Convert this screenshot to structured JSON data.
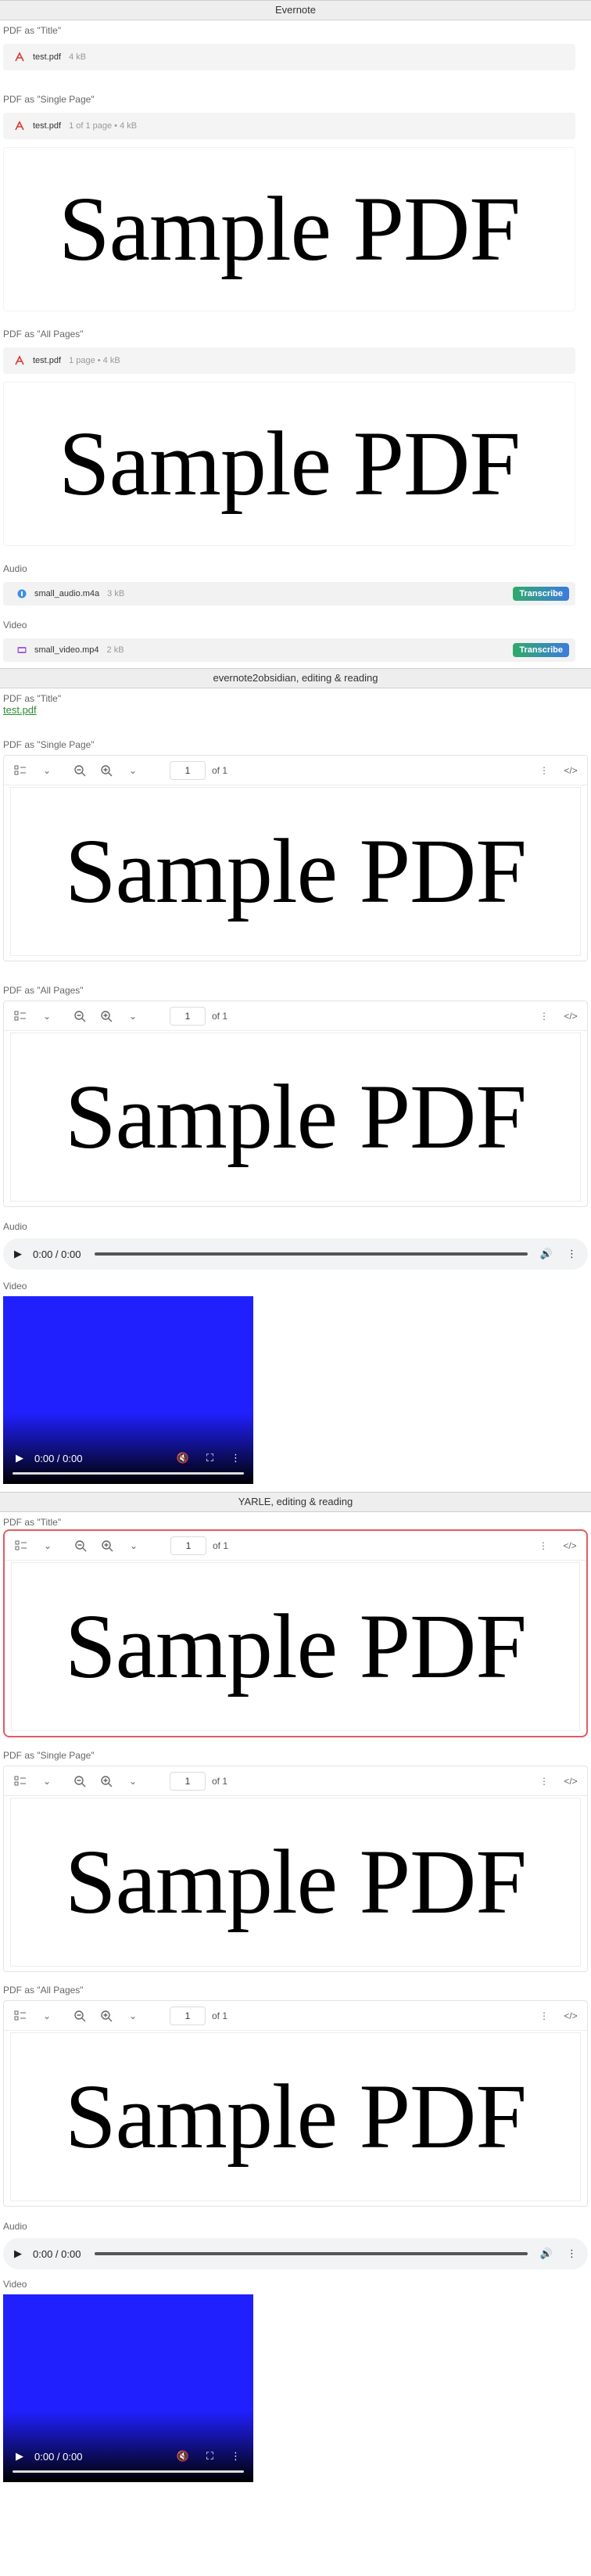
{
  "sections": {
    "evernote": {
      "header": "Evernote",
      "pdf_title": {
        "label": "PDF as \"Title\"",
        "filename": "test.pdf",
        "meta": "4 kB"
      },
      "pdf_single": {
        "label": "PDF as \"Single Page\"",
        "filename": "test.pdf",
        "meta": "1 of 1 page • 4 kB",
        "preview": "Sample PDF"
      },
      "pdf_all": {
        "label": "PDF as \"All Pages\"",
        "filename": "test.pdf",
        "meta": "1 page • 4 kB",
        "preview": "Sample PDF"
      },
      "audio": {
        "label": "Audio",
        "filename": "small_audio.m4a",
        "meta": "3 kB",
        "action": "Transcribe"
      },
      "video": {
        "label": "Video",
        "filename": "small_video.mp4",
        "meta": "2 kB",
        "action": "Transcribe"
      }
    },
    "e2o": {
      "header": "evernote2obsidian, editing & reading",
      "pdf_title": {
        "label": "PDF as \"Title\"",
        "link": "test.pdf"
      },
      "pdf_single": {
        "label": "PDF as \"Single Page\"",
        "page": "1",
        "of": "of 1",
        "preview": "Sample PDF"
      },
      "pdf_all": {
        "label": "PDF as \"All Pages\"",
        "page": "1",
        "of": "of 1",
        "preview": "Sample PDF"
      },
      "audio": {
        "label": "Audio",
        "time": "0:00 / 0:00"
      },
      "video": {
        "label": "Video",
        "time": "0:00 / 0:00"
      }
    },
    "yarle": {
      "header": "YARLE, editing & reading",
      "pdf_title": {
        "label": "PDF as \"Title\"",
        "page": "1",
        "of": "of 1",
        "preview": "Sample PDF"
      },
      "pdf_single": {
        "label": "PDF as \"Single Page\"",
        "page": "1",
        "of": "of 1",
        "preview": "Sample PDF"
      },
      "pdf_all": {
        "label": "PDF as \"All Pages\"",
        "page": "1",
        "of": "of 1",
        "preview": "Sample PDF"
      },
      "audio": {
        "label": "Audio",
        "time": "0:00 / 0:00"
      },
      "video": {
        "label": "Video",
        "time": "0:00 / 0:00"
      }
    }
  },
  "icons": {
    "pdf": "pdf-file-icon",
    "sidebar": "sidebar-thumbnails-icon",
    "zoom_out": "zoom-out-icon",
    "zoom_in": "zoom-in-icon",
    "more": "more-vertical-icon",
    "code": "code-icon"
  },
  "colors": {
    "pdf_red": "#d93a2f",
    "focus_red": "#e45a62",
    "link_green": "#2e8b32",
    "video_blue": "#2020ff"
  }
}
